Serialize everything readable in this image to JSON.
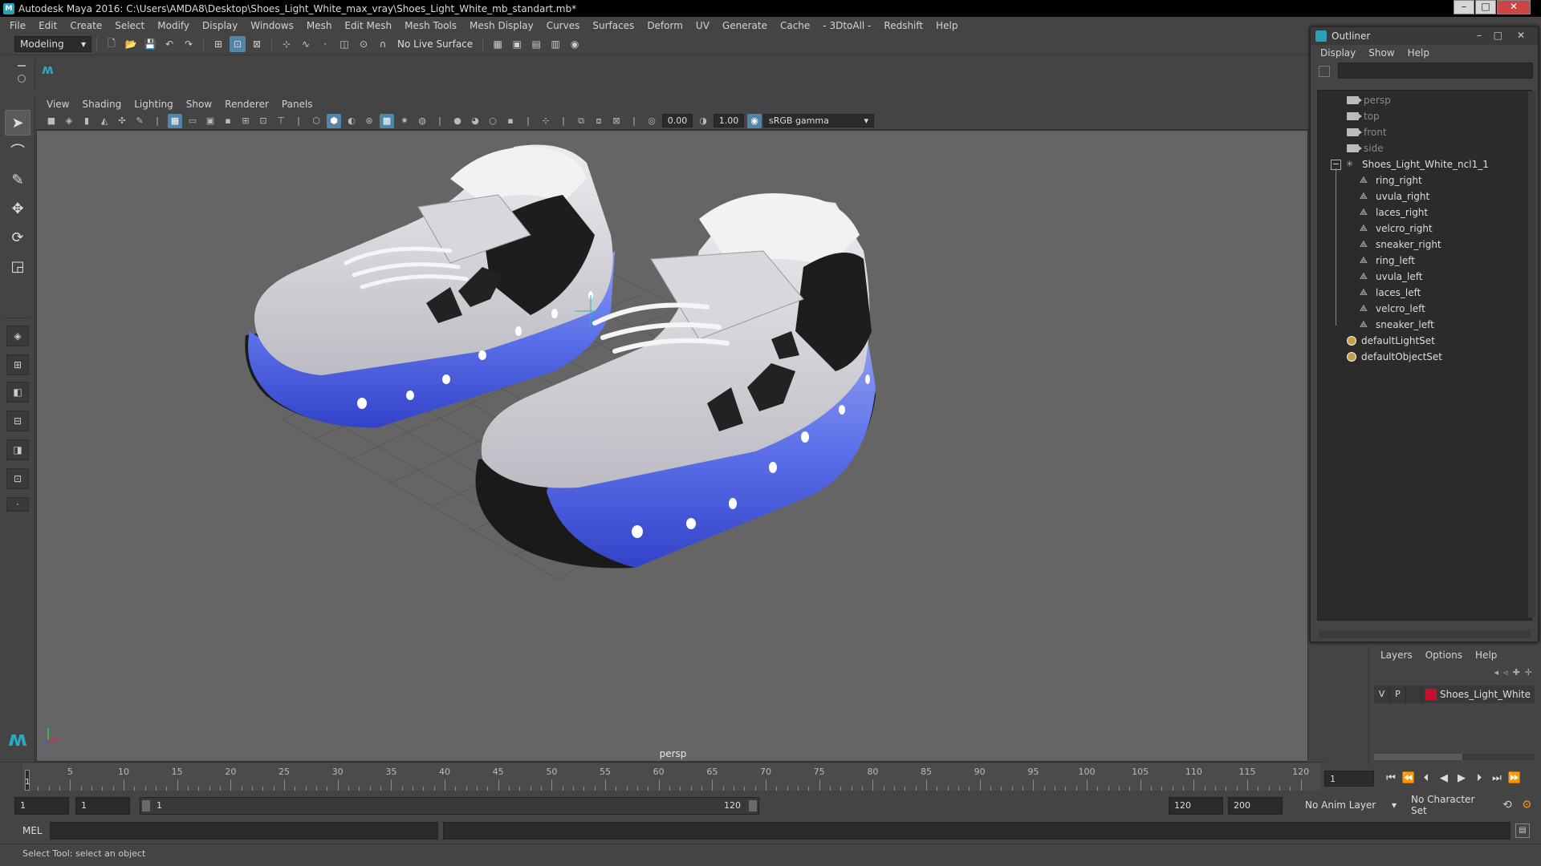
{
  "window": {
    "title": "Autodesk Maya 2016: C:\\Users\\AMDA8\\Desktop\\Shoes_Light_White_max_vray\\Shoes_Light_White_mb_standart.mb*",
    "minimize": "–",
    "maximize": "□",
    "close": "✕"
  },
  "main_menu": [
    "File",
    "Edit",
    "Create",
    "Select",
    "Modify",
    "Display",
    "Windows",
    "Mesh",
    "Edit Mesh",
    "Mesh Tools",
    "Mesh Display",
    "Curves",
    "Surfaces",
    "Deform",
    "UV",
    "Generate",
    "Cache",
    "- 3DtoAll -",
    "Redshift",
    "Help"
  ],
  "statusline": {
    "workspace": "Modeling",
    "live_surface": "No Live Surface"
  },
  "viewport": {
    "menu": [
      "View",
      "Shading",
      "Lighting",
      "Show",
      "Renderer",
      "Panels"
    ],
    "exposure": "0.00",
    "gamma": "1.00",
    "color_space": "sRGB gamma",
    "camera_label": "persp",
    "colors": {
      "sole_blue": "#4b5fe0",
      "upper": "#d8d6dc",
      "grid": "#555555",
      "background": "#656565"
    }
  },
  "outliner": {
    "title": "Outliner",
    "menu": [
      "Display",
      "Show",
      "Help"
    ],
    "cameras": [
      "persp",
      "top",
      "front",
      "side"
    ],
    "group": "Shoes_Light_White_ncl1_1",
    "children": [
      "ring_right",
      "uvula_right",
      "laces_right",
      "velcro_right",
      "sneaker_right",
      "ring_left",
      "uvula_left",
      "laces_left",
      "velcro_left",
      "sneaker_left"
    ],
    "sets": [
      "defaultLightSet",
      "defaultObjectSet"
    ]
  },
  "layers": {
    "menu": [
      "Layers",
      "Options",
      "Help"
    ],
    "row": {
      "v": "V",
      "p": "P",
      "name": "Shoes_Light_White",
      "color": "#c8102e"
    }
  },
  "timeline": {
    "ticks": [
      "5",
      "10",
      "15",
      "20",
      "25",
      "30",
      "35",
      "40",
      "45",
      "50",
      "55",
      "60",
      "65",
      "70",
      "75",
      "80",
      "85",
      "90",
      "95",
      "100",
      "105",
      "110",
      "115",
      "120"
    ],
    "current_frame": "1",
    "start_marker": "1"
  },
  "range": {
    "start": "1",
    "playback_start": "1",
    "slider_start": "1",
    "slider_end": "120",
    "playback_end": "120",
    "end": "200",
    "anim_layer": "No Anim Layer",
    "character_set": "No Character Set"
  },
  "cmdline": {
    "label": "MEL"
  },
  "helpline": {
    "text": "Select Tool: select an object"
  }
}
